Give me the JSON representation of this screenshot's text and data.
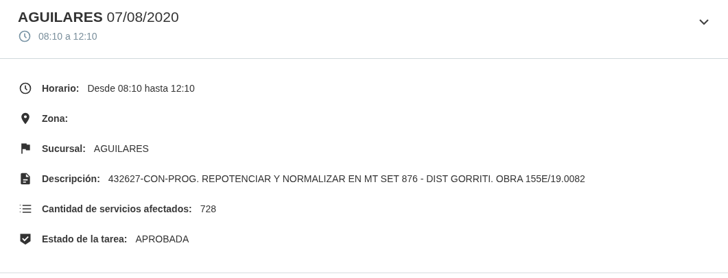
{
  "header": {
    "title": "AGUILARES",
    "date": "07/08/2020",
    "time_range": "08:10 a 12:10",
    "expanded": true
  },
  "details": [
    {
      "kind": "clock",
      "label": "Horario:",
      "value": "Desde 08:10 hasta 12:10"
    },
    {
      "kind": "pin",
      "label": "Zona:"
    },
    {
      "kind": "flag",
      "label": "Sucursal:",
      "value": "AGUILARES"
    },
    {
      "kind": "document",
      "label": "Descripción:",
      "value": "432627-CON-PROG. REPOTENCIAR Y NORMALIZAR EN MT SET 876 - DIST GORRITI. OBRA 155E/19.0082"
    },
    {
      "kind": "list",
      "label": "Cantidad de servicios afectados:",
      "value": "728"
    },
    {
      "kind": "shield",
      "label": "Estado de la tarea:",
      "value": "APROBADA"
    }
  ]
}
